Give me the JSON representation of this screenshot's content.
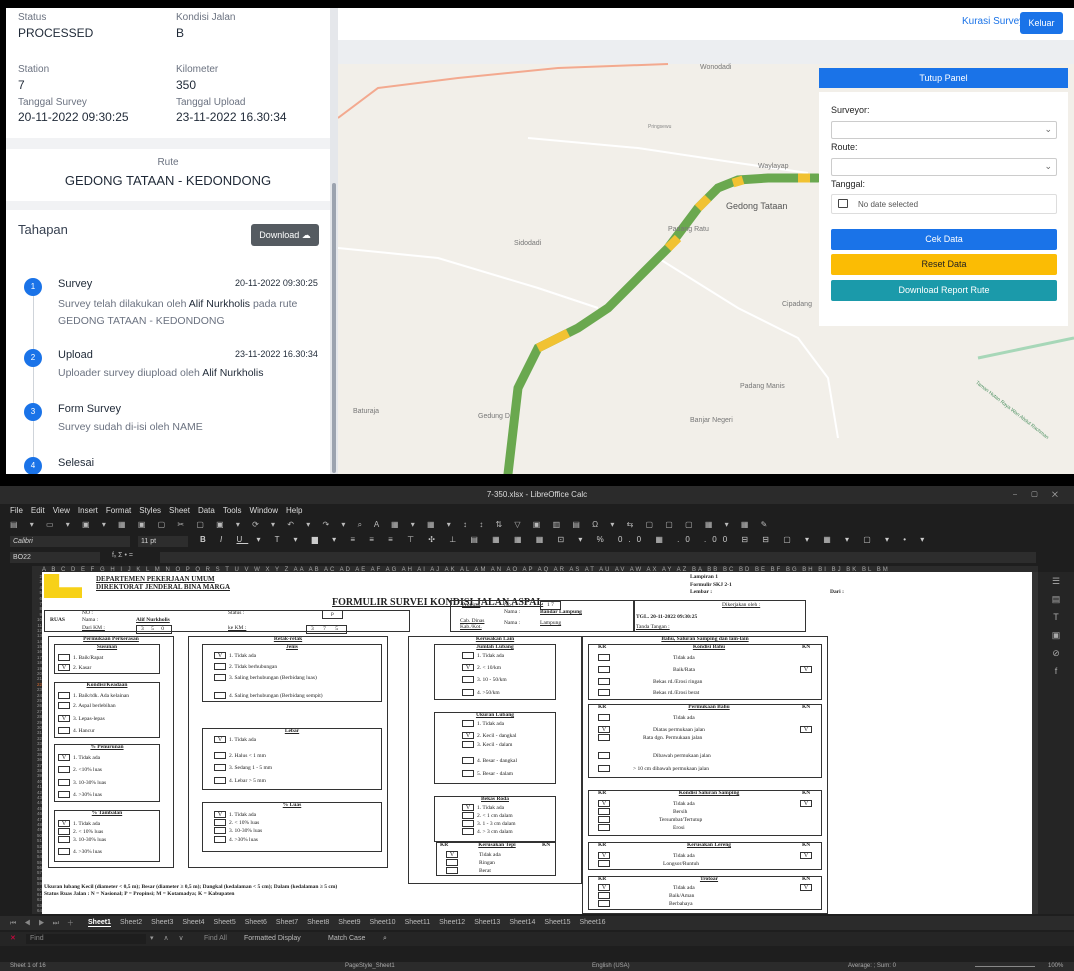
{
  "web": {
    "status_label": "Status",
    "status_value": "PROCESSED",
    "kondisi_label": "Kondisi Jalan",
    "kondisi_value": "B",
    "station_label": "Station",
    "station_value": "7",
    "km_label": "Kilometer",
    "km_value": "350",
    "tgl_survey_label": "Tanggal Survey",
    "tgl_survey_value": "20-11-2022 09:30:25",
    "tgl_upload_label": "Tanggal Upload",
    "tgl_upload_value": "23-11-2022 16.30:34",
    "rute_label": "Rute",
    "rute_value": "GEDONG TATAAN - KEDONDONG",
    "tahapan_title": "Tahapan",
    "download_label": "Download",
    "steps": [
      {
        "num": "1",
        "title": "Survey",
        "time": "20-11-2022 09:30:25",
        "desc_a": "Survey telah dilakukan oleh ",
        "desc_b": "Alif Nurkholis",
        "desc_c": " pada rute",
        "desc_d": "GEDONG TATAAN - KEDONDONG"
      },
      {
        "num": "2",
        "title": "Upload",
        "time": "23-11-2022 16.30:34",
        "desc_a": "Uploader survey diupload oleh ",
        "desc_b": "Alif Nurkholis"
      },
      {
        "num": "3",
        "title": "Form Survey",
        "desc_a": "Survey sudah di-isi oleh NAME"
      },
      {
        "num": "4",
        "title": "Selesai"
      }
    ],
    "kurasi_label": "Kurasi Survey",
    "keluar_label": "Keluar",
    "tutup_label": "Tutup Panel",
    "surveyor_label": "Surveyor:",
    "route_label": "Route:",
    "tanggal_label": "Tanggal:",
    "date_placeholder": "No date selected",
    "cek_label": "Cek Data",
    "reset_label": "Reset Data",
    "download_report_label": "Download Report Rute",
    "map_labels": [
      "Wonodadi",
      "Waylayap",
      "Gedong Tataan",
      "Padang Ratu",
      "Sidodadi",
      "Cipadang",
      "Padang Manis",
      "Banjar Negeri",
      "Baturaja",
      "Gedung D",
      "Taman Hutan Raya Wan Abdul Rachman",
      "Pringsewu"
    ]
  },
  "calc": {
    "window_title": "7-350.xlsx - LibreOffice Calc",
    "menu": [
      "File",
      "Edit",
      "View",
      "Insert",
      "Format",
      "Styles",
      "Sheet",
      "Data",
      "Tools",
      "Window",
      "Help"
    ],
    "font_name": "Calibri",
    "font_size": "11 pt",
    "cell_ref": "BO22",
    "formula_fx": "fₓ Σ • =",
    "columns": "A B C D E F G H I J K L M N O P Q R S T U V W X Y Z AA AB AC AD AE AF AG AH AI AJ AK AL AM AN AO AP AQ AR AS AT AU AV AW AX AY AZ BA BB BC BD BE BF BG BH BI BJ BK BL BM",
    "tabs": [
      "Sheet1",
      "Sheet2",
      "Sheet3",
      "Sheet4",
      "Sheet5",
      "Sheet6",
      "Sheet7",
      "Sheet8",
      "Sheet9",
      "Sheet10",
      "Sheet11",
      "Sheet12",
      "Sheet13",
      "Sheet14",
      "Sheet15",
      "Sheet16"
    ],
    "find_placeholder": "Find",
    "find_all": "Find All",
    "formatted_display": "Formatted Display",
    "match_case": "Match Case",
    "status_sheet": "Sheet 1 of 16",
    "status_style": "PageStyle_Sheet1",
    "status_lang": "English (USA)",
    "status_sum": "Average: ; Sum: 0",
    "status_zoom": "100%"
  },
  "form": {
    "dept1": "DEPARTEMEN PEKERJAAN UMUM",
    "dept2": "DIREKTORAT JENDERAL BINA MARGA",
    "title": "FORMULIR SURVEI KONDISI JALAN ASPAL",
    "lampiran": "Lampiran 1",
    "formulir": "Formulir SKJ 2-1",
    "lembar": "Lembar :",
    "dari": "Dari :",
    "ruas": "RUAS",
    "no_label": "NO :",
    "nama_label": "Nama :",
    "nama_value": "Alif Nurkholis",
    "status_label": "Status :",
    "status_value": "p",
    "dari_km": "Dari KM :",
    "dari_km_value": "3 5 0",
    "ke_km": "ke KM :",
    "ke_km_value": "3 7 5",
    "propinsi": "Propinsi",
    "no2": "No :",
    "no2_value": "1 7",
    "nama2": "Nama :",
    "nama2_value": "Bandar Lampung",
    "cab": "Cab. Dinas",
    "kab": "Kab./Kot.",
    "nama3": "Nama :",
    "nama3_value": "Lampung",
    "dikerjakan": "Dikerjakan oleh :",
    "tgl": "TGL. 20-11-2022 09:30:25",
    "tanda": "Tanda Tangan :",
    "col1_title": "Permukaan Perkerasan",
    "susunan": "Susunan",
    "susunan_items": [
      "1. Baik/Rapat",
      "2. Kasar"
    ],
    "kondisi": "Kondisi/Keadaan",
    "kondisi_items": [
      "1. Baik/tdk. Ada kelainan",
      "2. Aspal berlebihan",
      "3. Lepas-lepas",
      "4. Hancur"
    ],
    "penurunan": "% Penurunan",
    "penurunan_items": [
      "1. Tidak ada",
      "2. <10% luas",
      "3. 10-30% luas",
      "4. >30% luas"
    ],
    "tambalan": "% Tambalan",
    "tambalan_items": [
      "1. Tidak ada",
      "2. < 10% luas",
      "3. 10-30% luas",
      "4. >30% luas"
    ],
    "col2_title": "Retak-retak",
    "jenis": "Jenis",
    "jenis_items": [
      "1. Tidak ada",
      "2. Tidak berhubungan",
      "3. Saling berhubungan (Berbidang luas)",
      "4. Saling berhubungan (Berbidang sempit)"
    ],
    "lebar": "Lebar",
    "lebar_items": [
      "1. Tidak ada",
      "2. Halus < 1 mm",
      "3. Sedang 1 - 5 mm",
      "4. Lebar > 5 mm"
    ],
    "luas": "% Luas",
    "luas_items": [
      "1. Tidak ada",
      "2. < 10% luas",
      "3. 10-30% luas",
      "4. >30% luas"
    ],
    "col3_title": "Kerusakan Lain",
    "lubang": "Jumlah Lubang",
    "lubang_items": [
      "1. Tidak ada",
      "2. < 10/km",
      "3. 10 - 50/km",
      "4. >50/km"
    ],
    "ukuran": "Ukuran Lubang",
    "ukuran_items": [
      "1. Tidak ada",
      "2. Kecil - dangkal",
      "3. Kecil - dalam",
      "4. Besar - dangkal",
      "5. Besar - dalam"
    ],
    "roda": "Bekas Roda",
    "roda_items": [
      "1. Tidak ada",
      "2. < 1 cm dalam",
      "3. 1 - 3 cm dalam",
      "4. > 3 cm dalam"
    ],
    "tepi": "Kerusakan Tepi",
    "tepi_items": [
      "Tidak ada",
      "Ringan",
      "Berat"
    ],
    "col4_title": "Bahu, Saluran Samping dan lain-lain",
    "kr": "KR",
    "kn": "KN",
    "kbahu": "Kondisi Bahu",
    "kbahu_items": [
      "Tidak ada",
      "Baik/Rata",
      "Bekas rd./Erosi ringan",
      "Bekas rd./Erosi berat"
    ],
    "pbahu": "Permukaan Bahu",
    "pbahu_items": [
      "Tidak ada",
      "Diatas permukaan jalan",
      "Rata dgn. Permukaan jalan",
      "Dibawah permukaan jalan",
      "> 10 cm dibawah permukaan jalan"
    ],
    "saluran": "Kondisi Saluran Samping",
    "saluran_items": [
      "Tidak ada",
      "Bersih",
      "Tersumbat/Tertutup",
      "Erosi"
    ],
    "lereng": "Kerusakan Lereng",
    "lereng_items": [
      "Tidak ada",
      "Longsor/Runtuh"
    ],
    "trotoar": "Trotoar",
    "trotoar_items": [
      "Tidak ada",
      "Baik/Aman",
      "Berbahaya"
    ],
    "footer1": "Ukuran lubang Kecil (diameter < 0,5 m); Besar (diameter ≥ 0,5 m); Dangkal (kedalaman < 5 cm); Dalam (kedalaman ≥ 5 cm)",
    "footer2": "Status Ruas Jalan : N = Nasional; P = Propinsi; M = Kotamadya; K = Kabupaten",
    "check": "V"
  }
}
